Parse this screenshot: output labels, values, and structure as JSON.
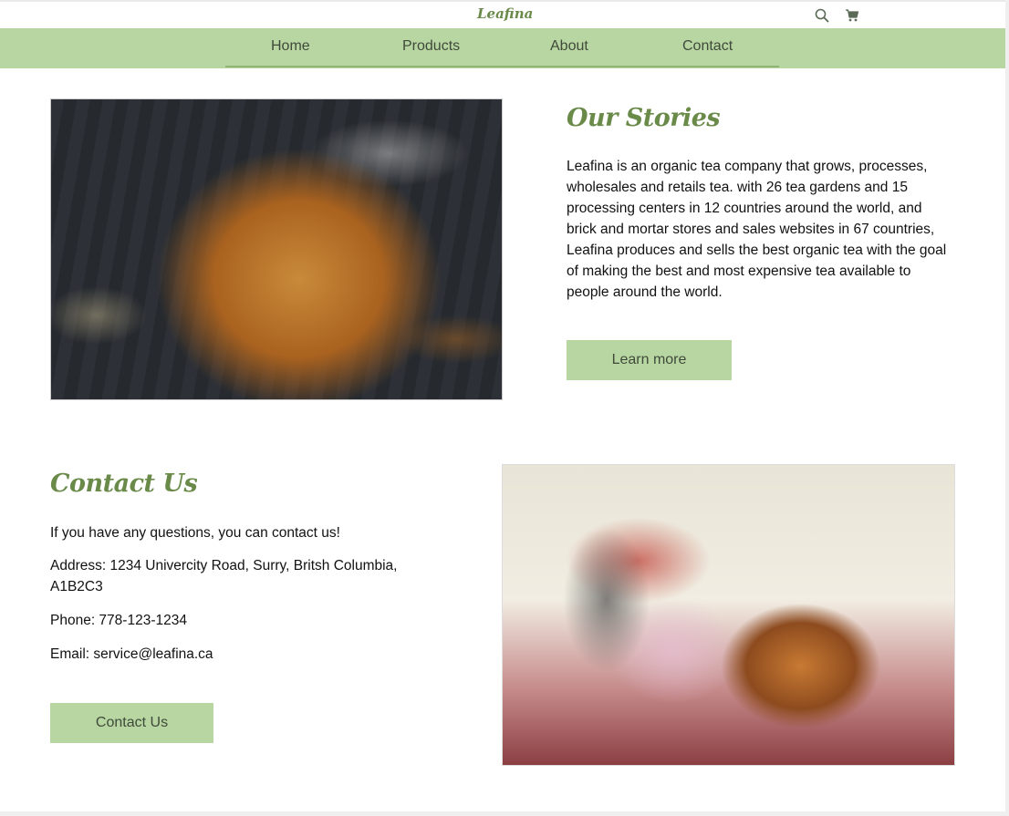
{
  "header": {
    "brand": "Leafina",
    "icons": [
      "search-icon",
      "cart-icon"
    ]
  },
  "nav": {
    "items": [
      "Home",
      "Products",
      "About",
      "Contact"
    ]
  },
  "stories": {
    "title": "Our Stories",
    "body": "Leafina is an organic tea company that grows, processes, wholesales and retails tea. with 26 tea gardens and 15 processing centers in 12 countries around the world, and brick and mortar stores and sales websites in 67 countries, Leafina produces and sells the best organic tea with the goal of making the best and most expensive tea available to people around the world.",
    "button": "Learn more"
  },
  "contact": {
    "title": "Contact Us",
    "intro": "If you have any questions, you can contact us!",
    "address": "Address: 1234 Univercity Road, Surry, Britsh Columbia, A1B2C3",
    "phone": "Phone: 778-123-1234",
    "email": "Email: service@leafina.ca",
    "button": "Contact Us"
  },
  "colors": {
    "accent": "#b8d6a2",
    "heading": "#6a8a4a"
  }
}
